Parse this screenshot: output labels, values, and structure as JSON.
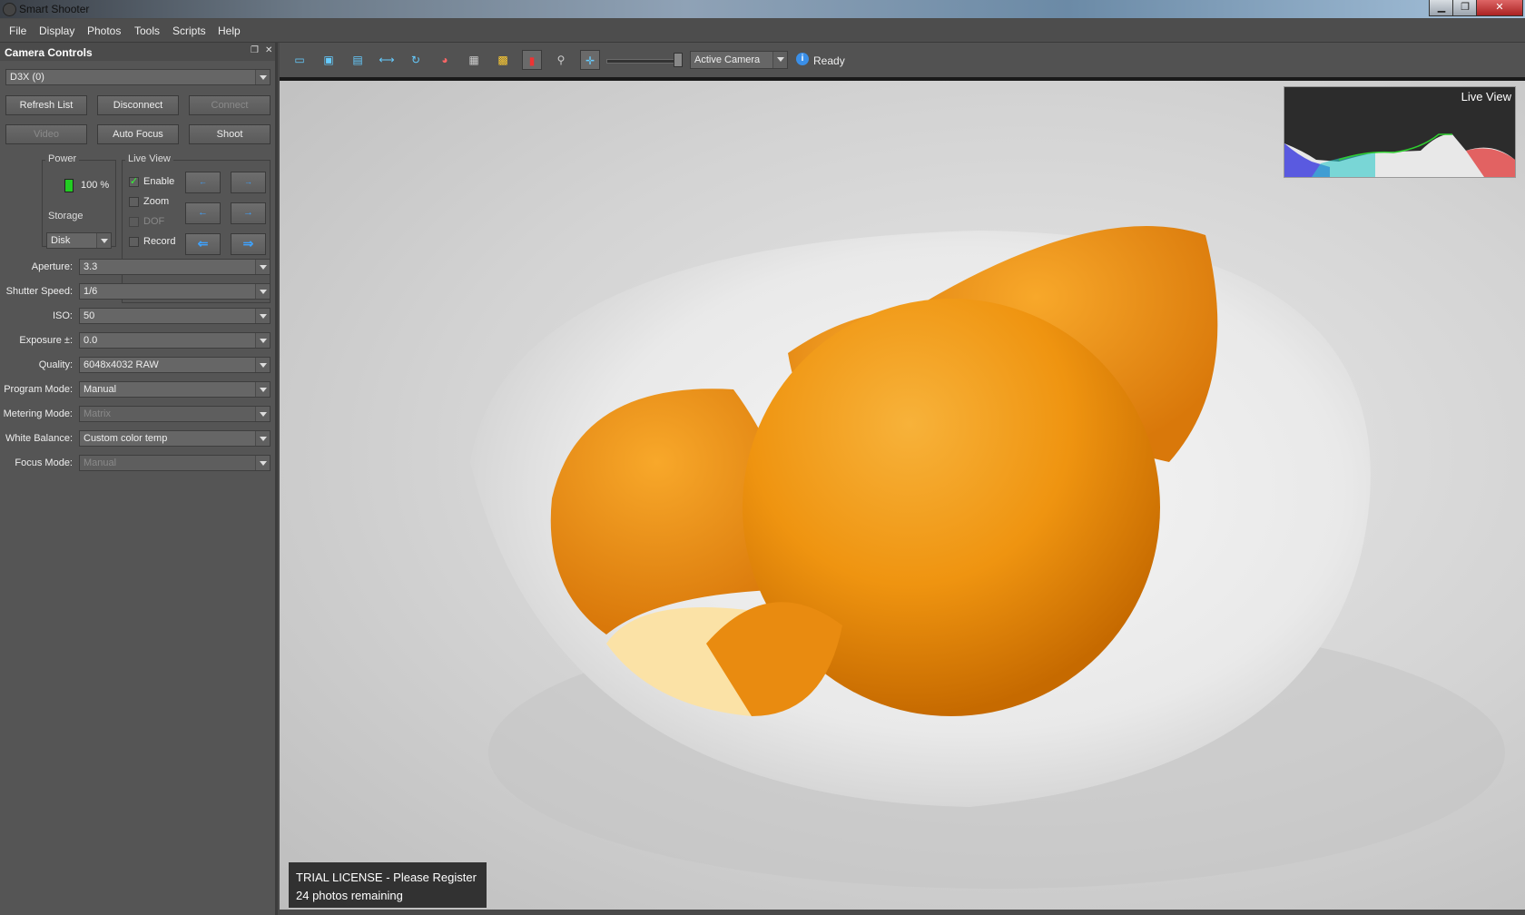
{
  "window": {
    "title": "Smart Shooter",
    "icon": "app-icon"
  },
  "menu": [
    "File",
    "Display",
    "Photos",
    "Tools",
    "Scripts",
    "Help"
  ],
  "panel": {
    "title": "Camera Controls",
    "camera_select": "D3X (0)",
    "buttons": {
      "refresh": "Refresh List",
      "disconnect": "Disconnect",
      "connect": "Connect",
      "video": "Video",
      "autofocus": "Auto Focus",
      "shoot": "Shoot"
    },
    "power": {
      "label": "Power",
      "value": "100 %"
    },
    "storage": {
      "label": "Storage",
      "value": "Disk"
    },
    "liveview": {
      "label": "Live View",
      "enable": "Enable",
      "zoom": "Zoom",
      "dof": "DOF",
      "record": "Record"
    },
    "fields": [
      {
        "label": "Aperture:",
        "value": "3.3",
        "disabled": false
      },
      {
        "label": "Shutter Speed:",
        "value": "1/6",
        "disabled": false
      },
      {
        "label": "ISO:",
        "value": "50",
        "disabled": false
      },
      {
        "label": "Exposure ±:",
        "value": "0.0",
        "disabled": false
      },
      {
        "label": "Quality:",
        "value": "6048x4032 RAW",
        "disabled": false
      },
      {
        "label": "Program Mode:",
        "value": "Manual",
        "disabled": false
      },
      {
        "label": "Metering Mode:",
        "value": "Matrix",
        "disabled": true
      },
      {
        "label": "White Balance:",
        "value": "Custom color temp",
        "disabled": false
      },
      {
        "label": "Focus Mode:",
        "value": "Manual",
        "disabled": true
      }
    ]
  },
  "toolbar": {
    "camera_select": "Active Camera",
    "status": "Ready"
  },
  "histogram": {
    "label": "Live View"
  },
  "trial": {
    "line1": "TRIAL LICENSE - Please Register",
    "line2": "24 photos remaining"
  }
}
